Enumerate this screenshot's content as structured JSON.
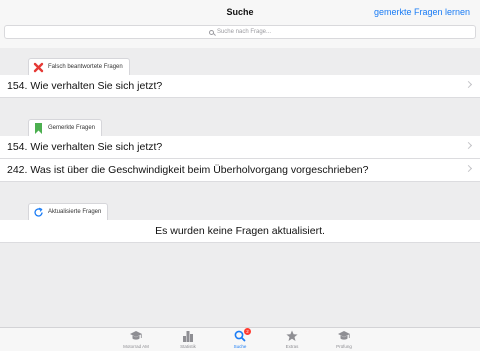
{
  "nav": {
    "title": "Suche",
    "right_button": "gemerkte Fragen lernen",
    "search_placeholder": "Suche nach Frage..."
  },
  "sections": {
    "wrong": {
      "title": "Falsch beantwortete Fragen",
      "icon": "red-x-icon",
      "rows": [
        "154. Wie verhalten Sie sich jetzt?"
      ]
    },
    "bookmarked": {
      "title": "Gemerkte Fragen",
      "icon": "bookmark-icon",
      "rows": [
        "154. Wie verhalten Sie sich jetzt?",
        "242. Was ist über die Geschwindigkeit beim Überholvorgang vorgeschrieben?"
      ]
    },
    "updated": {
      "title": "Aktualisierte Fragen",
      "icon": "refresh-icon",
      "message": "Es wurden keine Fragen aktualisiert."
    }
  },
  "tabbar": {
    "tabs": [
      {
        "label": "Motorrad AM",
        "icon": "mortarboard-icon"
      },
      {
        "label": "Statistik",
        "icon": "bar-chart-icon"
      },
      {
        "label": "Suche",
        "icon": "search-icon",
        "badge": "2",
        "active": true
      },
      {
        "label": "Extras",
        "icon": "star-icon"
      },
      {
        "label": "Prüfung",
        "icon": "mortarboard-icon"
      }
    ]
  },
  "colors": {
    "accent": "#1a7cf5",
    "red": "#e53935",
    "green": "#4caf50",
    "background": "#ededee"
  }
}
